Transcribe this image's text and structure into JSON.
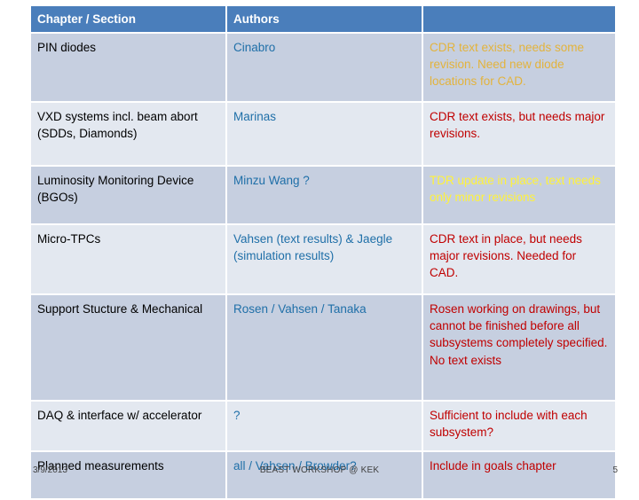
{
  "table": {
    "headers": [
      "Chapter / Section",
      "Authors",
      ""
    ],
    "rows": [
      {
        "section": "PIN diodes",
        "authors": "Cinabro",
        "status": "CDR text exists, needs some revision. Need new diode locations for CAD.",
        "status_tone": "gold",
        "band": "dark"
      },
      {
        "section": "VXD systems incl. beam abort (SDDs, Diamonds)",
        "authors": "Marinas",
        "status": "CDR text exists, but needs major revisions.",
        "status_tone": "red",
        "band": "light"
      },
      {
        "section": "Luminosity Monitoring Device (BGOs)",
        "authors": "Minzu Wang ?",
        "status": "TDR update in place, text needs only minor revisions",
        "status_tone": "yellow",
        "band": "dark"
      },
      {
        "section": "Micro-TPCs",
        "authors": "Vahsen (text results) & Jaegle (simulation results)",
        "status": "CDR text in place, but needs major revisions. Needed for CAD.",
        "status_tone": "red",
        "band": "light"
      },
      {
        "section": "Support Stucture & Mechanical",
        "authors": "Rosen / Vahsen / Tanaka",
        "status": "Rosen working on drawings, but cannot be finished before all subsystems completely specified. No text exists",
        "status_tone": "red",
        "band": "dark"
      },
      {
        "section": "DAQ & interface w/ accelerator",
        "authors": "?",
        "status": "Sufficient to include with each subsystem?",
        "status_tone": "red",
        "band": "light"
      },
      {
        "section": "Planned measurements",
        "authors": "all / Vahsen / Browder?",
        "status": "Include in goals chapter",
        "status_tone": "red",
        "band": "dark"
      }
    ]
  },
  "footer": {
    "date": "3/9/2013",
    "center": "BEAST WORKSHOP @ KEK",
    "page": "5"
  },
  "colors": {
    "header_blue": "#4A7EBB",
    "band_dark": "#C6CFE0",
    "band_light": "#E3E8F0",
    "author_blue": "#1F6FA8",
    "status_red": "#C00000",
    "status_gold": "#E3B33C",
    "status_yellow": "#FFF23A"
  }
}
